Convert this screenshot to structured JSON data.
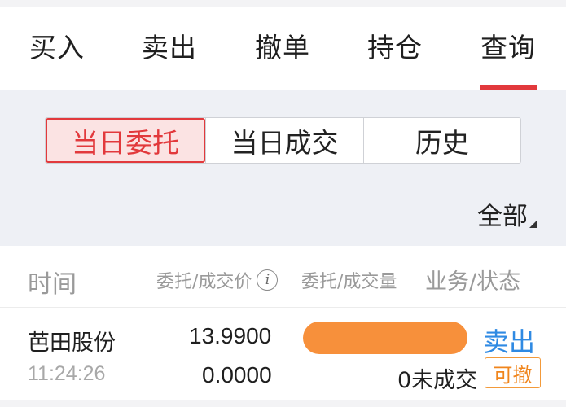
{
  "tabs": [
    {
      "label": "买入"
    },
    {
      "label": "卖出"
    },
    {
      "label": "撤单"
    },
    {
      "label": "持仓"
    },
    {
      "label": "查询",
      "active": true
    }
  ],
  "segments": [
    {
      "label": "当日委托",
      "active": true
    },
    {
      "label": "当日成交"
    },
    {
      "label": "历史"
    }
  ],
  "filter": {
    "label": "全部"
  },
  "columns": {
    "time": "时间",
    "price": "委托/成交价",
    "qty": "委托/成交量",
    "status": "业务/状态",
    "info_icon": "i"
  },
  "orders": [
    {
      "name": "芭田股份",
      "time": "11:24:26",
      "order_price": "13.9900",
      "deal_price": "0.0000",
      "filled": "0未成交",
      "side": "卖出",
      "action": "可撤"
    }
  ],
  "colors": {
    "accent": "#e2393c",
    "sell": "#2f8ae3",
    "bar": "#f7903b",
    "cancel": "#f0851c"
  }
}
